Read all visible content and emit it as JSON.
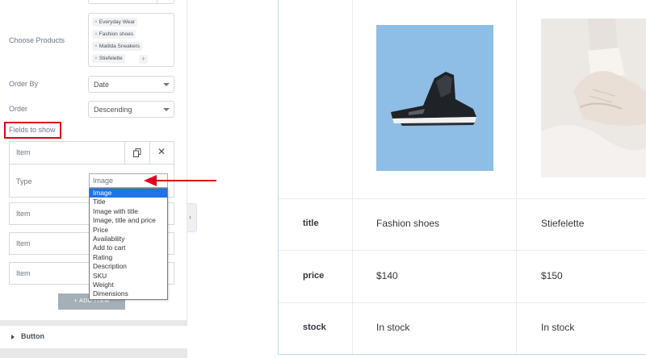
{
  "editor": {
    "choose_products_label": "Choose Products",
    "products": [
      "Everyday Wear",
      "Fashion shoes",
      "Matilda Sneakers",
      "Stiefelette"
    ],
    "order_by_label": "Order By",
    "order_by_value": "Date",
    "order_label": "Order",
    "order_value": "Descending",
    "fields_label": "Fields to show",
    "item_label": "Item",
    "type_label": "Type",
    "type_value": "Image",
    "type_options": [
      "Image",
      "Title",
      "Image with title",
      "Image, title and price",
      "Price",
      "Availability",
      "Add to cart",
      "Rating",
      "Description",
      "SKU",
      "Weight",
      "Dimensions"
    ],
    "add_item_label": "+ ADD ITEM",
    "button_section_label": "Button"
  },
  "preview": {
    "rows": [
      {
        "key": "title",
        "values": [
          "Fashion shoes",
          "Stiefelette"
        ]
      },
      {
        "key": "price",
        "values": [
          "$140",
          "$150"
        ]
      },
      {
        "key": "stock",
        "values": [
          "In stock",
          "In stock"
        ]
      }
    ]
  },
  "colors": {
    "highlight": "#e0001b",
    "selected_option": "#1e73e8",
    "shoe_bg": "#8ebde6"
  }
}
